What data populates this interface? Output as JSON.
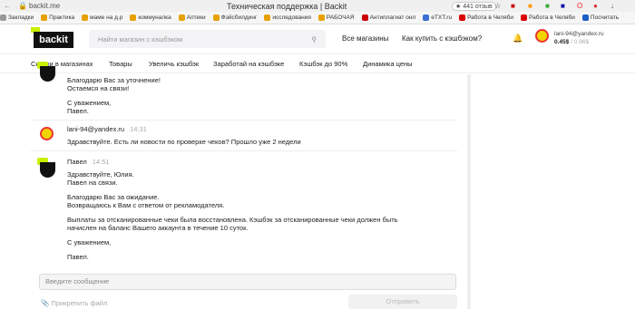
{
  "browser": {
    "url": "backit.me",
    "title": "Техническая поддержка | Backit",
    "reviews": "★ 441 отзыв"
  },
  "bookmarks": [
    {
      "label": "Закладки",
      "color": "#999"
    },
    {
      "label": "Практика",
      "color": "#e6a100"
    },
    {
      "label": "маме на д.р",
      "color": "#e6a100"
    },
    {
      "label": "коммуналка",
      "color": "#e6a100"
    },
    {
      "label": "Аптеки",
      "color": "#e6a100"
    },
    {
      "label": "Фэйсбилдинг",
      "color": "#e6a100"
    },
    {
      "label": "исследования",
      "color": "#e6a100"
    },
    {
      "label": "РАБОЧАЯ",
      "color": "#e6a100"
    },
    {
      "label": "Антиплагиат онл",
      "color": "#c00"
    },
    {
      "label": "eTXT.ru",
      "color": "#3b6fd6"
    },
    {
      "label": "Работа в Челяби",
      "color": "#d00"
    },
    {
      "label": "Работа в Челяби",
      "color": "#d00"
    },
    {
      "label": "Посчитать",
      "color": "#1b5fc4"
    }
  ],
  "header": {
    "logo": "backit",
    "search_placeholder": "Найти магазин с кэшбэком",
    "all_stores": "Все магазины",
    "how_to_buy": "Как купить с кэшбэком?",
    "account_email": "lani-94@yandex.ru",
    "balance": "0.45$",
    "balance_total": "/ 0.96$"
  },
  "menu": [
    "Скидки в магазинах",
    "Товары",
    "Увеличь кэшбэк",
    "Заработай на кэшбэке",
    "Кэшбэк до 90%",
    "Динамика цены"
  ],
  "messages": {
    "m1_lines": [
      "Благодарю Вас за уточнение!",
      "Остаемся на связи!",
      "",
      "С уважением,",
      "Павел."
    ],
    "m2_name": "lani-94@yandex.ru",
    "m2_time": "14:31",
    "m2_text": "Здравствуйте. Есть ли новости по проверке чеков? Прошло уже 2 недели",
    "m3_name": "Павел",
    "m3_time": "14:51",
    "m3_lines": [
      "Здравствуйте, Юлия.",
      "Павел на связи.",
      "Благодарю Вас за ожидание.",
      "Возвращаюсь к Вам с ответом от рекламодателя.",
      "Выплаты за отсканированные чеки была восстановлена. Кэшбэк за отсканированные чеки должен быть",
      "начислен на баланс Вашего аккаунта в течение 10 суток.",
      "С уважением,",
      "Павел."
    ]
  },
  "composer": {
    "placeholder": "Введите сообщение",
    "attach": "Прикрепить файл",
    "send": "Отправить"
  }
}
